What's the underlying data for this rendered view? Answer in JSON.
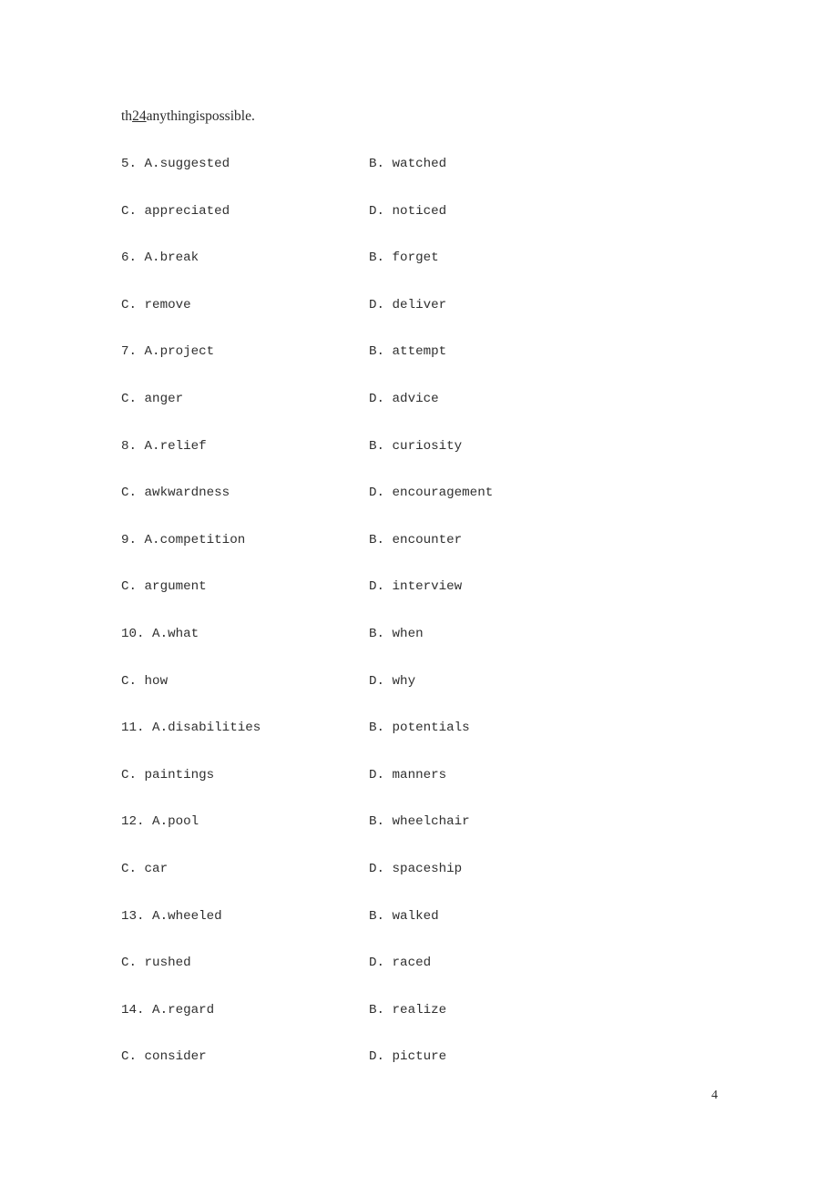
{
  "document": {
    "page_number": "4",
    "text_color": "#2b2b2b",
    "background_color": "#ffffff"
  },
  "passage": {
    "prefix": "th",
    "blank_number": "24",
    "suffix": "anythingispossible."
  },
  "questions": [
    {
      "number": "5.",
      "a_label": "A.",
      "a_text": "suggested",
      "b_label": "B.",
      "b_text": "watched",
      "c_label": "C.",
      "c_text": "appreciated",
      "d_label": "D.",
      "d_text": "noticed",
      "row_top": "5. A.suggested",
      "row_top_right": "B. watched",
      "row_bottom": "C. appreciated",
      "row_bottom_right": "D. noticed"
    },
    {
      "number": "6.",
      "a_label": "A.",
      "a_text": "break",
      "b_label": "B.",
      "b_text": "forget",
      "c_label": "C.",
      "c_text": "remove",
      "d_label": "D.",
      "d_text": "deliver",
      "row_top": "6. A.break",
      "row_top_right": "B. forget",
      "row_bottom": "C. remove",
      "row_bottom_right": "D. deliver"
    },
    {
      "number": "7.",
      "a_label": "A.",
      "a_text": "project",
      "b_label": "B.",
      "b_text": "attempt",
      "c_label": "C.",
      "c_text": "anger",
      "d_label": "D.",
      "d_text": "advice",
      "row_top": "7. A.project",
      "row_top_right": "B. attempt",
      "row_bottom": "C. anger",
      "row_bottom_right": "D. advice"
    },
    {
      "number": "8.",
      "a_label": "A.",
      "a_text": "relief",
      "b_label": "B.",
      "b_text": "curiosity",
      "c_label": "C.",
      "c_text": "awkwardness",
      "d_label": "D.",
      "d_text": "encouragement",
      "row_top": "8. A.relief",
      "row_top_right": "B. curiosity",
      "row_bottom": "C. awkwardness",
      "row_bottom_right": "D. encouragement"
    },
    {
      "number": "9.",
      "a_label": "A.",
      "a_text": "competition",
      "b_label": "B.",
      "b_text": "encounter",
      "c_label": "C.",
      "c_text": "argument",
      "d_label": "D.",
      "d_text": "interview",
      "row_top": "9. A.competition",
      "row_top_right": "B. encounter",
      "row_bottom": "C. argument",
      "row_bottom_right": "D. interview"
    },
    {
      "number": "10.",
      "a_label": "A.",
      "a_text": "what",
      "b_label": "B.",
      "b_text": "when",
      "c_label": "C.",
      "c_text": "how",
      "d_label": "D.",
      "d_text": "why",
      "row_top": "10. A.what",
      "row_top_right": "B. when",
      "row_bottom": "C. how",
      "row_bottom_right": "D. why"
    },
    {
      "number": "11.",
      "a_label": "A.",
      "a_text": "disabilities",
      "b_label": "B.",
      "b_text": "potentials",
      "c_label": "C.",
      "c_text": "paintings",
      "d_label": "D.",
      "d_text": "manners",
      "row_top": "11. A.disabilities",
      "row_top_right": "B. potentials",
      "row_bottom": "C. paintings",
      "row_bottom_right": "D. manners"
    },
    {
      "number": "12.",
      "a_label": "A.",
      "a_text": "pool",
      "b_label": "B.",
      "b_text": "wheelchair",
      "c_label": "C.",
      "c_text": "car",
      "d_label": "D.",
      "d_text": "spaceship",
      "row_top": "12. A.pool",
      "row_top_right": "B. wheelchair",
      "row_bottom": "C. car",
      "row_bottom_right": "D. spaceship"
    },
    {
      "number": "13.",
      "a_label": "A.",
      "a_text": "wheeled",
      "b_label": "B.",
      "b_text": "walked",
      "c_label": "C.",
      "c_text": "rushed",
      "d_label": "D.",
      "d_text": "raced",
      "row_top": "13. A.wheeled",
      "row_top_right": "B. walked",
      "row_bottom": "C. rushed",
      "row_bottom_right": "D. raced"
    },
    {
      "number": "14.",
      "a_label": "A.",
      "a_text": "regard",
      "b_label": "B.",
      "b_text": "realize",
      "c_label": "C.",
      "c_text": "consider",
      "d_label": "D.",
      "d_text": "picture",
      "row_top": "14. A.regard",
      "row_top_right": "B. realize",
      "row_bottom": "C. consider",
      "row_bottom_right": "D. picture"
    }
  ]
}
